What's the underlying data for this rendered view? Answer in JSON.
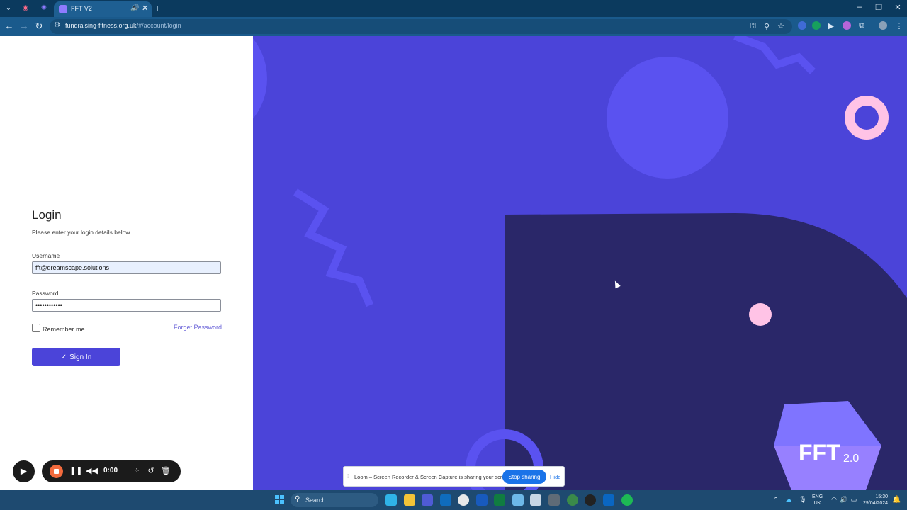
{
  "browser": {
    "tab_title": "FFT V2",
    "new_tab": "+",
    "url_domain": "fundraising-fitness.org.uk",
    "url_path": "/#/account/login",
    "window_controls": {
      "minimize": "–",
      "restore": "❐",
      "close": "✕"
    }
  },
  "login": {
    "title": "Login",
    "subtitle": "Please enter your login details below.",
    "username_label": "Username",
    "username_value": "fft@dreamscape.solutions",
    "password_label": "Password",
    "password_value": "••••••••••••",
    "remember_label": "Remember me",
    "forget_label": "Forget Password",
    "signin_label": "Sign In",
    "signin_icon": "✓"
  },
  "brand": {
    "logo_text": "FFT",
    "logo_version": "2.0",
    "background_color": "#4b44d9",
    "accent_color": "#2a2769",
    "pink_color": "#ffc3e6"
  },
  "loom": {
    "timer": "0:00",
    "share_message": "Loom – Screen Recorder & Screen Capture is sharing your screen.",
    "stop_sharing": "Stop sharing",
    "hide": "Hide"
  },
  "taskbar": {
    "search_placeholder": "Search",
    "lang_top": "ENG",
    "lang_bottom": "UK",
    "time": "15:30",
    "date": "29/04/2024"
  }
}
